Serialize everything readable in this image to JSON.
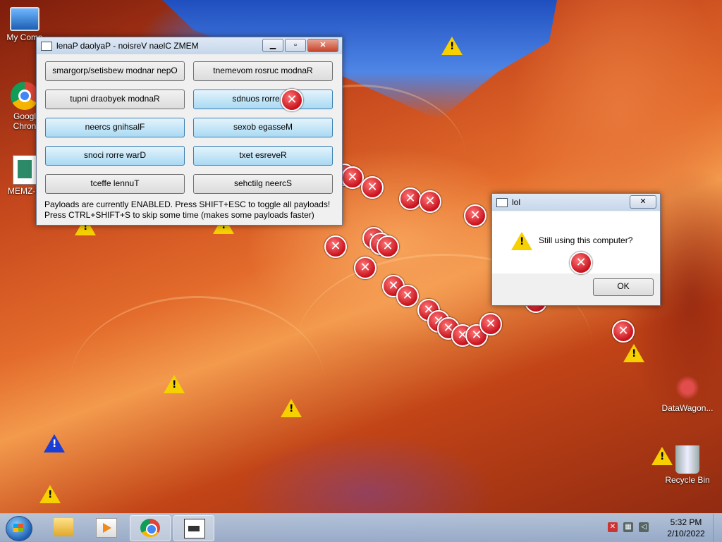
{
  "desktop": {
    "icons": [
      {
        "label": "My Comp",
        "icon": "computer-icon"
      },
      {
        "label": "Googl Chron",
        "icon": "chrome-icon"
      },
      {
        "label": "MEMZ-C",
        "icon": "document-icon"
      },
      {
        "label": "DataWagon...",
        "icon": "datawagon-icon"
      },
      {
        "label": "Recycle Bin",
        "icon": "recycle-bin-icon"
      }
    ]
  },
  "memz_window": {
    "title": "lenaP daolyaP - noisreV naelC ZMEM",
    "buttons": [
      {
        "label": "smargorp/setisbew modnar nepO",
        "enabled": false
      },
      {
        "label": "tnemevom rosruc modnaR",
        "enabled": false
      },
      {
        "label": "tupni draobyek modnaR",
        "enabled": false
      },
      {
        "label": "sdnuos rorre mo",
        "enabled": true
      },
      {
        "label": "neercs gnihsalF",
        "enabled": true
      },
      {
        "label": "sexob egasseM",
        "enabled": true
      },
      {
        "label": "snoci rorre warD",
        "enabled": true
      },
      {
        "label": "txet esreveR",
        "enabled": true
      },
      {
        "label": "tceffe lennuT",
        "enabled": false
      },
      {
        "label": "sehctilg neercS",
        "enabled": false
      }
    ],
    "status_line1": "Payloads are currently ENABLED. Press SHIFT+ESC to toggle all payloads!",
    "status_line2": "Press CTRL+SHIFT+S to skip some time (makes some payloads faster)"
  },
  "lol_dialog": {
    "title": "lol",
    "message": "Still using this computer?",
    "ok_label": "OK"
  },
  "taskbar": {
    "apps": [
      "explorer-icon",
      "media-player-icon",
      "chrome-icon",
      "memz-app-icon"
    ],
    "active_app": "memz-app-icon",
    "time": "5:32 PM",
    "date": "2/10/2022"
  },
  "colors": {
    "error_red": "#c8111d",
    "warning_yellow": "#f6d000",
    "info_blue": "#1b3fd6",
    "button_enabled_blue": "#a9d9f3"
  }
}
